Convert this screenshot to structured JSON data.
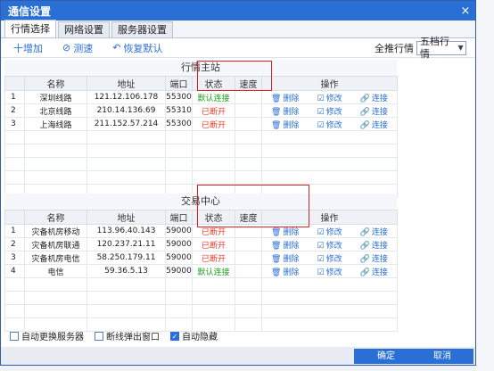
{
  "window": {
    "title": "通信设置",
    "close": "×"
  },
  "tabs": [
    {
      "label": "行情选择"
    },
    {
      "label": "网络设置"
    },
    {
      "label": "服务器设置"
    }
  ],
  "toolbar": {
    "add": "十增加",
    "test": "测速",
    "restore": "恢复默认",
    "push_label": "全推行情",
    "push_value": "五档行情"
  },
  "columns": [
    "名称",
    "地址",
    "端口",
    "状态",
    "速度",
    "操作"
  ],
  "market": {
    "title": "行情主站",
    "rows": [
      {
        "idx": "1",
        "name": "深圳线路",
        "addr": "121.12.106.178",
        "port": "55300",
        "status": "默认连接",
        "ok": true
      },
      {
        "idx": "2",
        "name": "北京线路",
        "addr": "210.14.136.69",
        "port": "55310",
        "status": "已断开",
        "ok": false
      },
      {
        "idx": "3",
        "name": "上海线路",
        "addr": "211.152.57.214",
        "port": "55300",
        "status": "已断开",
        "ok": false
      }
    ]
  },
  "trade": {
    "title": "交易中心",
    "rows": [
      {
        "idx": "1",
        "name": "灾备机房移动",
        "addr": "113.96.40.143",
        "port": "59000",
        "status": "已断开",
        "ok": false
      },
      {
        "idx": "2",
        "name": "灾备机房联通",
        "addr": "120.237.21.11",
        "port": "59000",
        "status": "已断开",
        "ok": false
      },
      {
        "idx": "3",
        "name": "灾备机房电信",
        "addr": "58.250.179.11",
        "port": "59000",
        "status": "已断开",
        "ok": false
      },
      {
        "idx": "4",
        "name": "电信",
        "addr": "59.36.5.13",
        "port": "59000",
        "status": "默认连接",
        "ok": true
      }
    ]
  },
  "ops": {
    "delete": "删除",
    "edit": "修改",
    "connect": "连接"
  },
  "options": [
    {
      "label": "自动更换服务器",
      "checked": false
    },
    {
      "label": "断线弹出窗口",
      "checked": false
    },
    {
      "label": "自动隐藏",
      "checked": true
    }
  ],
  "buttons": {
    "ok": "确定",
    "cancel": "取消"
  },
  "colors": {
    "accent": "#2a6fd6",
    "ok": "#1aa31a",
    "bad": "#ee3b2b",
    "highlight": "#e02020"
  }
}
